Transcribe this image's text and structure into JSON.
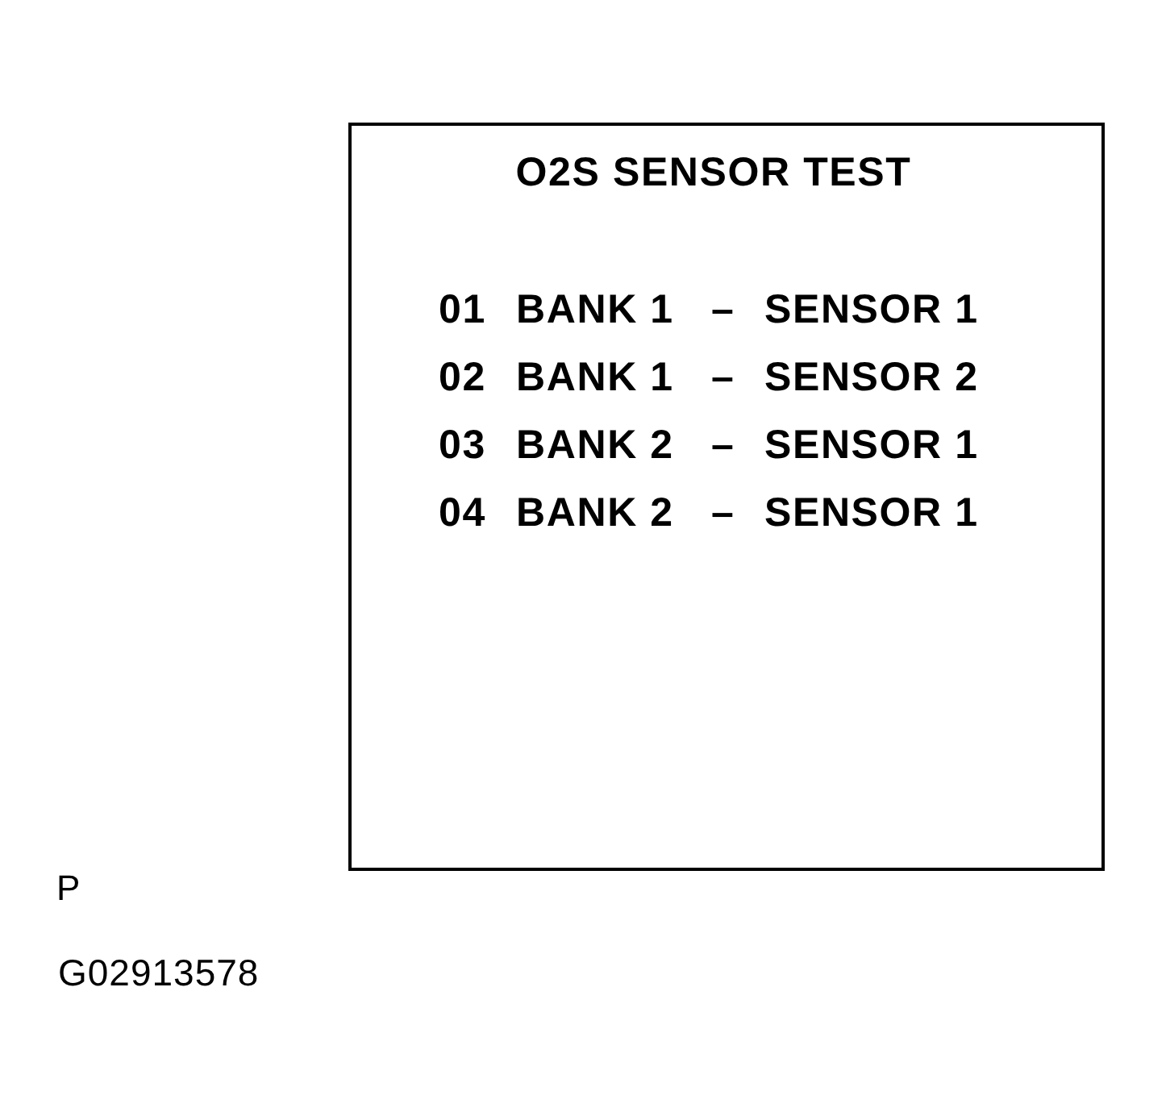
{
  "screen": {
    "title": "O2S SENSOR TEST",
    "rows": [
      {
        "code": "01",
        "bank": "BANK 1",
        "separator": "–",
        "sensor": "SENSOR 1"
      },
      {
        "code": "02",
        "bank": "BANK 1",
        "separator": "–",
        "sensor": "SENSOR 2"
      },
      {
        "code": "03",
        "bank": "BANK 2",
        "separator": "–",
        "sensor": "SENSOR 1"
      },
      {
        "code": "04",
        "bank": "BANK 2",
        "separator": "–",
        "sensor": "SENSOR 1"
      }
    ]
  },
  "view_label": "P",
  "figure_id": "G02913578"
}
